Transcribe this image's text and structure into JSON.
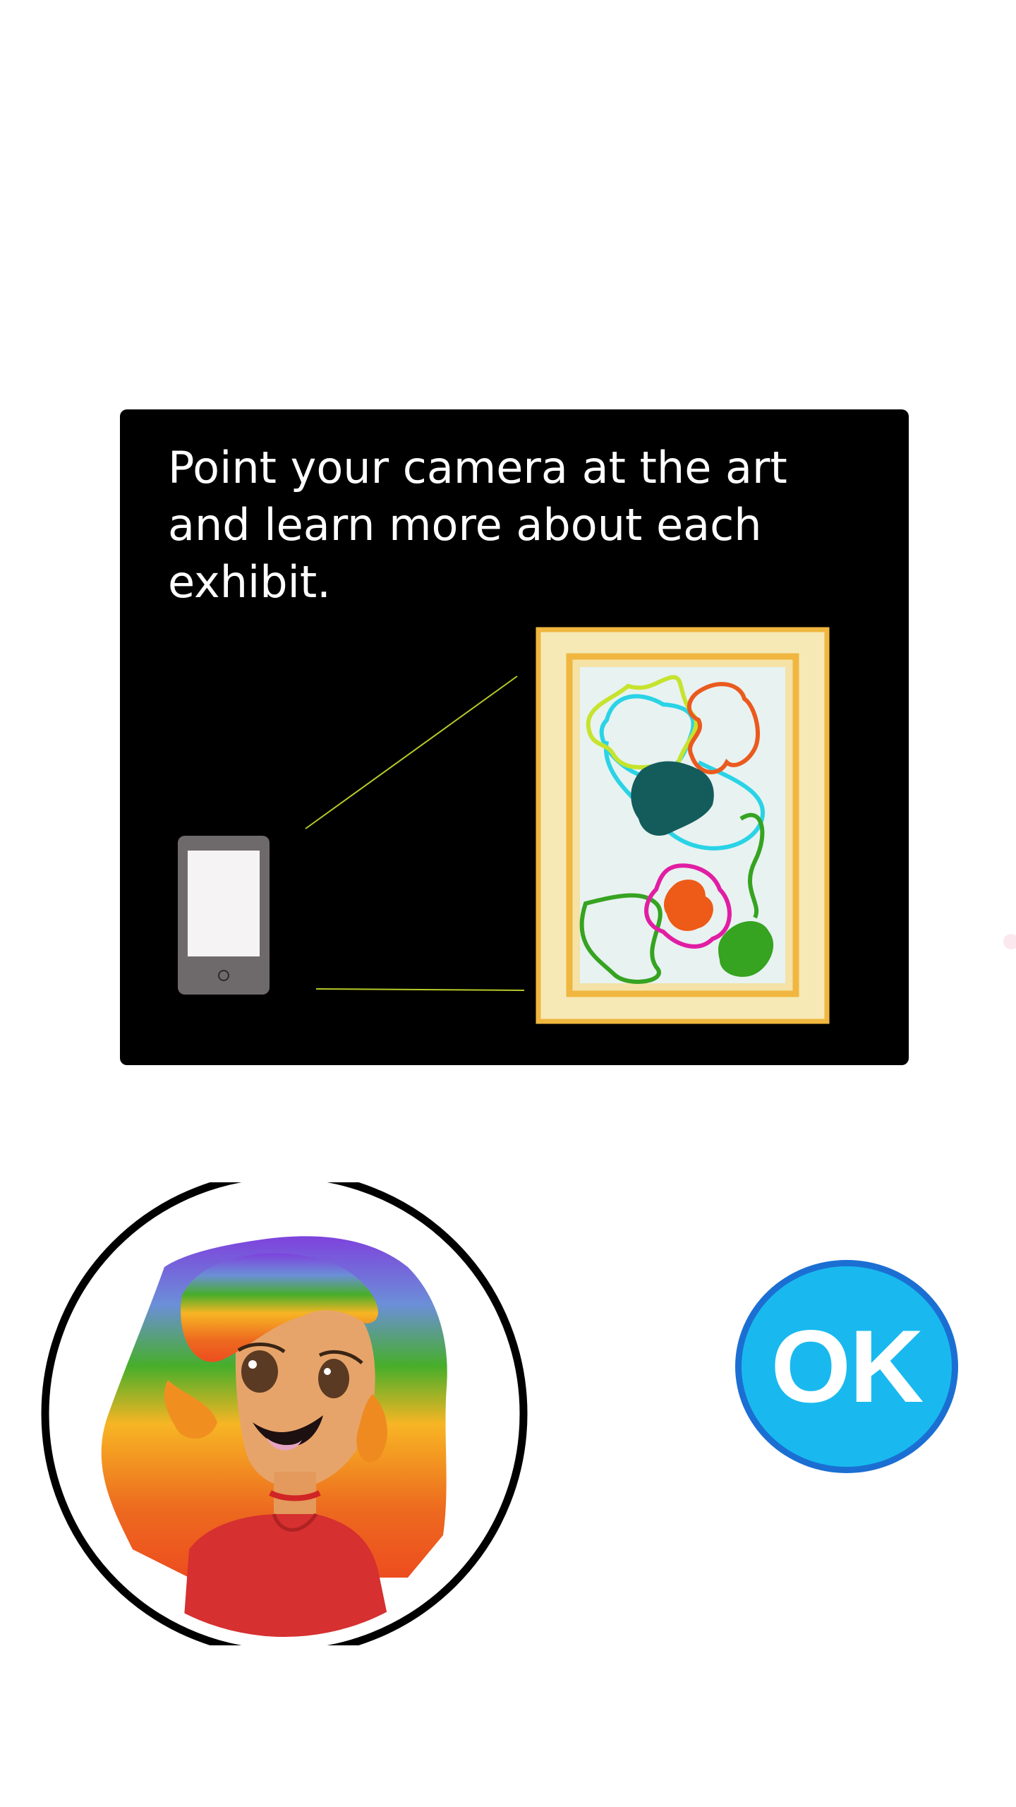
{
  "instruction": {
    "text": "Point your camera at the art and learn more about each exhibit."
  },
  "illustration": {
    "device_icon": "phone-icon",
    "artwork_icon": "framed-painting-icon"
  },
  "guide": {
    "avatar_icon": "rainbow-hair-guide-avatar"
  },
  "ok_button": {
    "label": "OK",
    "fill_color": "#19b9ef",
    "border_color": "#1b6fd3"
  },
  "colors": {
    "card_background": "#000000",
    "page_background": "#ffffff",
    "frame_gold": "#f0b63f"
  }
}
